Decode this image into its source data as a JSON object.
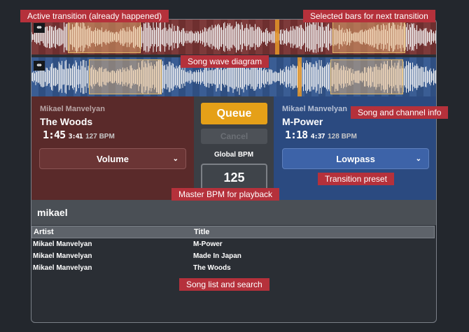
{
  "annotations": {
    "active_transition": "Active transition (already happened)",
    "selected_bars": "Selected bars for next transition",
    "wave_diagram": "Song wave diagram",
    "song_channel_info": "Song and channel info",
    "transition_preset": "Transition preset",
    "master_bpm": "Master BPM for playback",
    "song_list": "Song list and search"
  },
  "wave": {
    "icon": "split-icon",
    "top_color": "#6e2f2f",
    "bottom_color": "#2f4f82"
  },
  "deck_left": {
    "artist": "Mikael Manvelyan",
    "title": "The Woods",
    "current_time": "1:45",
    "total_time": "3:41",
    "bpm": "127 BPM",
    "preset": "Volume",
    "accent": "#5a2a2a"
  },
  "deck_right": {
    "artist": "Mikael Manvelyan",
    "title": "M-Power",
    "current_time": "1:18",
    "total_time": "4:37",
    "bpm": "128 BPM",
    "preset": "Lowpass",
    "accent": "#2b4a80"
  },
  "center": {
    "queue_label": "Queue",
    "cancel_label": "Cancel",
    "bpm_label": "Global BPM",
    "bpm_value": "125",
    "queue_color": "#e5a018"
  },
  "search": {
    "value": "mikael"
  },
  "song_table": {
    "columns": [
      "Artist",
      "Title"
    ],
    "rows": [
      {
        "artist": "Mikael Manvelyan",
        "title": "M-Power"
      },
      {
        "artist": "Mikael Manvelyan",
        "title": "Made In Japan"
      },
      {
        "artist": "Mikael Manvelyan",
        "title": "The Woods"
      }
    ]
  }
}
